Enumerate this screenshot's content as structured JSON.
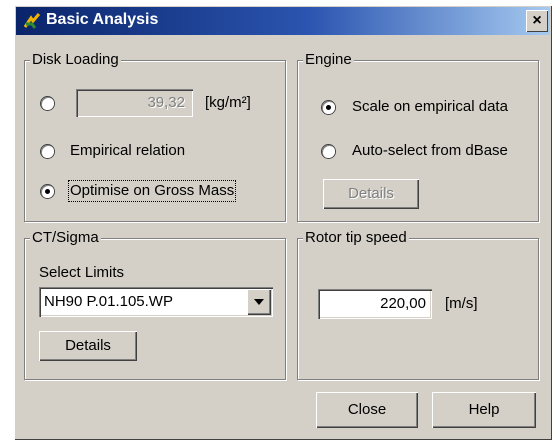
{
  "window": {
    "title": "Basic Analysis",
    "close_glyph": "×"
  },
  "disk_loading": {
    "group_label": "Disk Loading",
    "value": "39,32",
    "unit": "[kg/m²]",
    "option_empirical": "Empirical relation",
    "option_optimise": "Optimise on Gross Mass",
    "selected": "optimise"
  },
  "engine": {
    "group_label": "Engine",
    "option_scale": "Scale on empirical data",
    "option_autoselect": "Auto-select from dBase",
    "details_label": "Details",
    "selected": "scale"
  },
  "ct_sigma": {
    "group_label": "CT/Sigma",
    "select_limits_label": "Select Limits",
    "selected_limit": "NH90 P.01.105.WP",
    "details_label": "Details"
  },
  "rotor_tip_speed": {
    "group_label": "Rotor tip speed",
    "value": "220,00",
    "unit": "[m/s]"
  },
  "footer": {
    "close_label": "Close",
    "help_label": "Help"
  },
  "colors": {
    "title_bar_start": "#0a246a",
    "title_bar_end": "#a6caf0",
    "face": "#d4d0c8"
  },
  "icons": {
    "app": "helicopter-app-icon",
    "close": "close-icon",
    "dropdown": "dropdown-arrow-icon"
  }
}
